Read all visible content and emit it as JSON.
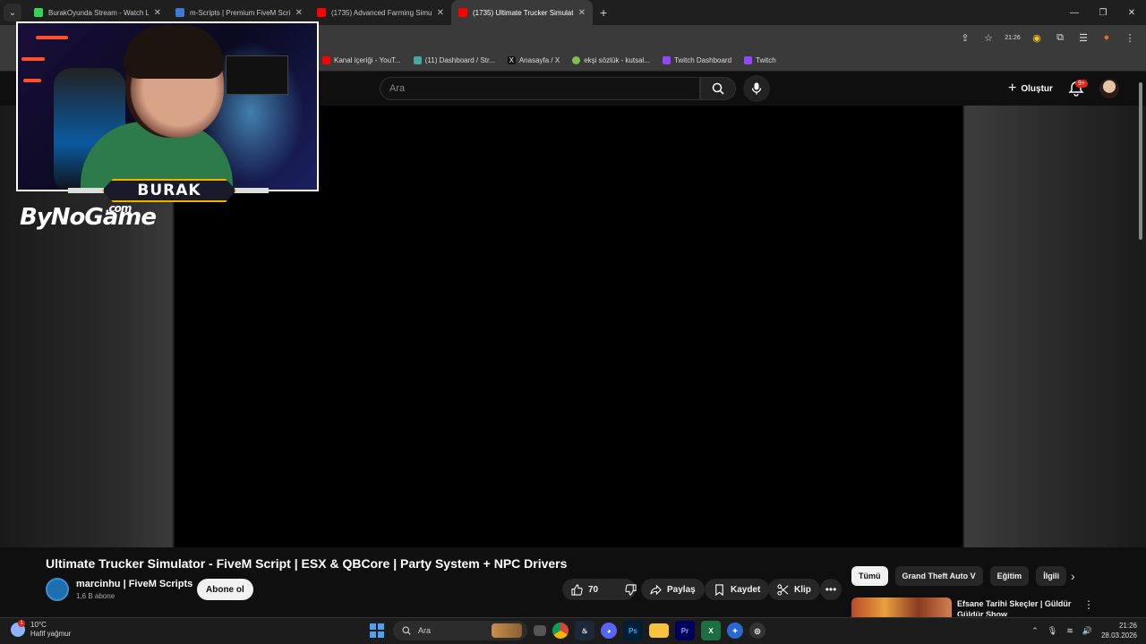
{
  "browser": {
    "tabs": [
      {
        "title": "BurakOyunda Stream - Watch L",
        "color": "#39d353",
        "active": false
      },
      {
        "title": "m-Scripts | Premium FiveM Scri",
        "color": "#3a7bd5",
        "active": false
      },
      {
        "title": "(1735) Advanced Farming Simu",
        "color": "#ff0000",
        "active": false
      },
      {
        "title": "(1735) Ultimate Trucker Simulat",
        "color": "#ff0000",
        "active": true
      }
    ],
    "toolbar_clock_badge": "21:26",
    "bookmarks": [
      {
        "label": "Kanal içeriği - YouT...",
        "color": "#ff0000"
      },
      {
        "label": "(11) Dashboard / Str...",
        "color": "#47a7a0"
      },
      {
        "label": "Anasayfa / X",
        "color": "#111111"
      },
      {
        "label": "ekşi sözlük - kutsal...",
        "color": "#81c14b"
      },
      {
        "label": "Twitch Dashboard",
        "color": "#9146ff"
      },
      {
        "label": "Twitch",
        "color": "#9146ff"
      }
    ]
  },
  "youtube": {
    "search_placeholder": "Ara",
    "create_label": "Oluştur",
    "notification_badge": "9+"
  },
  "overlay": {
    "streamer_name": "BURAK",
    "brand": "ByNoGame",
    "brand_suffix": ".com"
  },
  "video": {
    "title": "Ultimate Trucker Simulator - FiveM Script | ESX & QBCore | Party System + NPC Drivers",
    "channel_name": "marcinhu | FiveM Scripts",
    "subscribers": "1,6 B abone",
    "subscribe_label": "Abone ol",
    "like_count": "70",
    "share_label": "Paylaş",
    "save_label": "Kaydet",
    "clip_label": "Klip"
  },
  "related": {
    "chips": [
      {
        "label": "Tümü",
        "selected": true
      },
      {
        "label": "Grand Theft Auto V",
        "selected": false
      },
      {
        "label": "Eğitim",
        "selected": false
      },
      {
        "label": "İlgili",
        "selected": false
      }
    ],
    "first_item_title": "Efsane Tarihi Skeçler | Güldür Güldür Show"
  },
  "taskbar": {
    "temperature": "10°C",
    "weather": "Hafif yağmur",
    "weather_badge": "1",
    "search_placeholder": "Ara",
    "time": "21:26",
    "date": "28.03.2026"
  }
}
